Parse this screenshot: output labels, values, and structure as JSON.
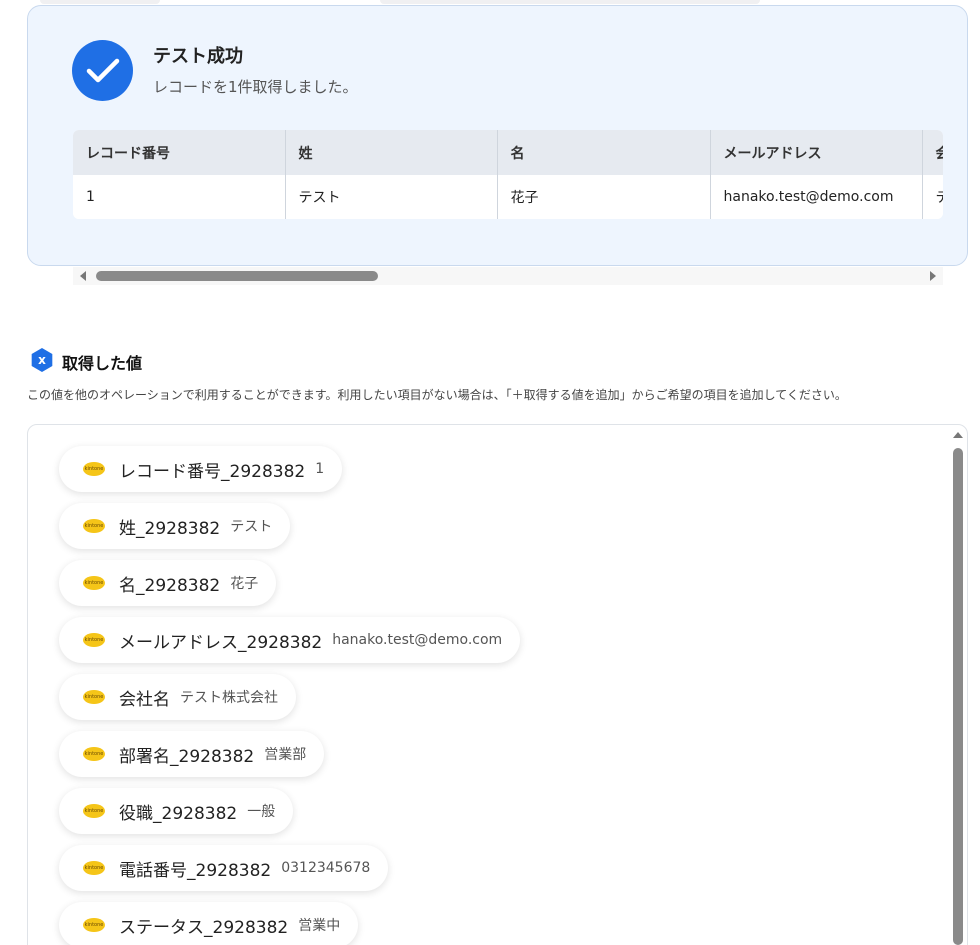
{
  "success": {
    "title": "テスト成功",
    "subtitle": "レコードを1件取得しました。"
  },
  "result_table": {
    "columns": [
      "レコード番号",
      "姓",
      "名",
      "メールアドレス",
      "会"
    ],
    "rows": [
      [
        "1",
        "テスト",
        "花子",
        "hanako.test@demo.com",
        "テ"
      ]
    ]
  },
  "section": {
    "title": "取得した値",
    "icon_text": "x",
    "description": "この値を他のオペレーションで利用することができます。利用したい項目がない場合は、「＋取得する値を追加」からご希望の項目を追加してください。"
  },
  "values": [
    {
      "name": "レコード番号_2928382",
      "value": "1"
    },
    {
      "name": "姓_2928382",
      "value": "テスト"
    },
    {
      "name": "名_2928382",
      "value": "花子"
    },
    {
      "name": "メールアドレス_2928382",
      "value": "hanako.test@demo.com"
    },
    {
      "name": "会社名",
      "value": "テスト株式会社"
    },
    {
      "name": "部署名_2928382",
      "value": "営業部"
    },
    {
      "name": "役職_2928382",
      "value": "一般"
    },
    {
      "name": "電話番号_2928382",
      "value": "0312345678"
    },
    {
      "name": "ステータス_2928382",
      "value": "営業中"
    }
  ],
  "colors": {
    "accent": "#1f6fe5",
    "panel_bg": "#eef5fe",
    "logo": "#f5c518"
  },
  "icons": {
    "success": "check-icon",
    "section": "hexagon-x-icon",
    "pill_logo": "kintone-logo-icon"
  }
}
